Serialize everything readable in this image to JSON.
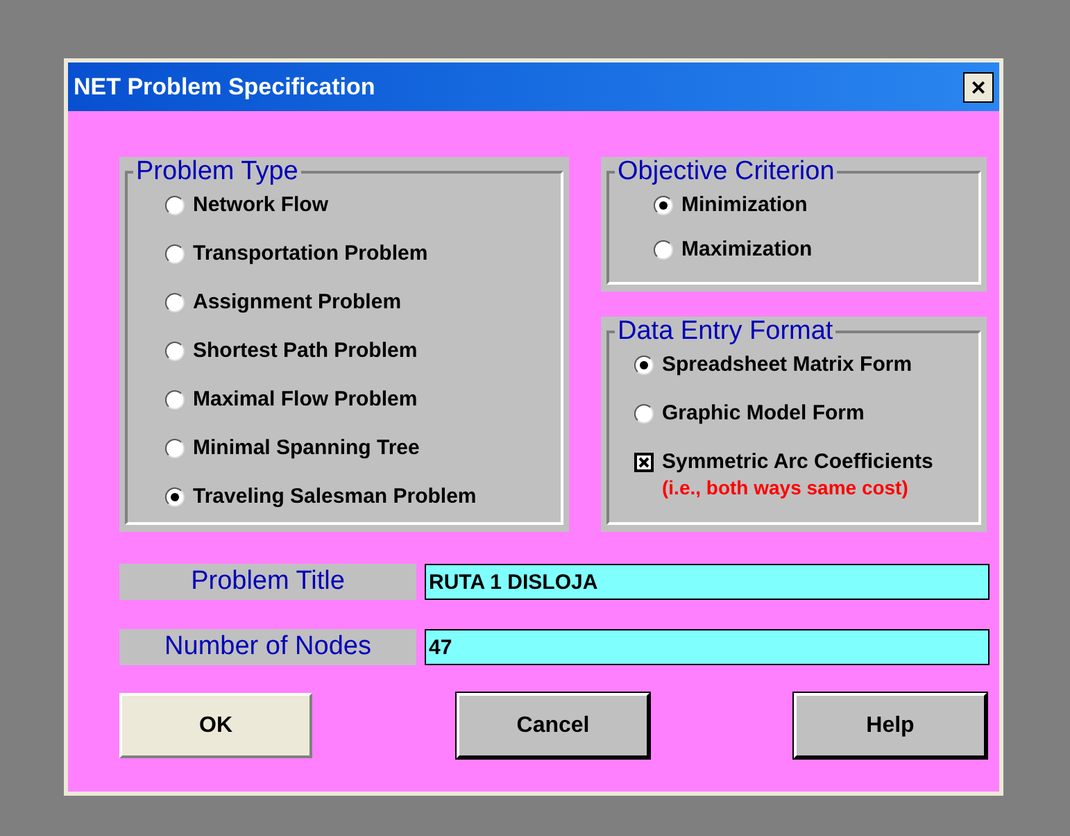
{
  "window": {
    "title": "NET Problem Specification",
    "close": "×"
  },
  "problem_type": {
    "title": "Problem Type",
    "options": [
      {
        "label": "Network Flow",
        "selected": false
      },
      {
        "label": "Transportation Problem",
        "selected": false
      },
      {
        "label": "Assignment Problem",
        "selected": false
      },
      {
        "label": "Shortest Path Problem",
        "selected": false
      },
      {
        "label": "Maximal Flow Problem",
        "selected": false
      },
      {
        "label": "Minimal Spanning Tree",
        "selected": false
      },
      {
        "label": "Traveling Salesman Problem",
        "selected": true
      }
    ]
  },
  "objective": {
    "title": "Objective Criterion",
    "options": [
      {
        "label": "Minimization",
        "selected": true
      },
      {
        "label": "Maximization",
        "selected": false
      }
    ]
  },
  "data_entry": {
    "title": "Data Entry Format",
    "options": [
      {
        "label": "Spreadsheet Matrix Form",
        "selected": true
      },
      {
        "label": "Graphic Model Form",
        "selected": false
      }
    ],
    "symmetric": {
      "label": "Symmetric Arc Coefficients",
      "note": "(i.e., both ways same cost)",
      "checked": true
    }
  },
  "fields": [
    {
      "label": "Problem Title",
      "value": "RUTA 1 DISLOJA"
    },
    {
      "label": "Number of Nodes",
      "value": "47"
    }
  ],
  "buttons": [
    {
      "label": "OK",
      "default": true
    },
    {
      "label": "Cancel",
      "default": false
    },
    {
      "label": "Help",
      "default": false
    }
  ]
}
